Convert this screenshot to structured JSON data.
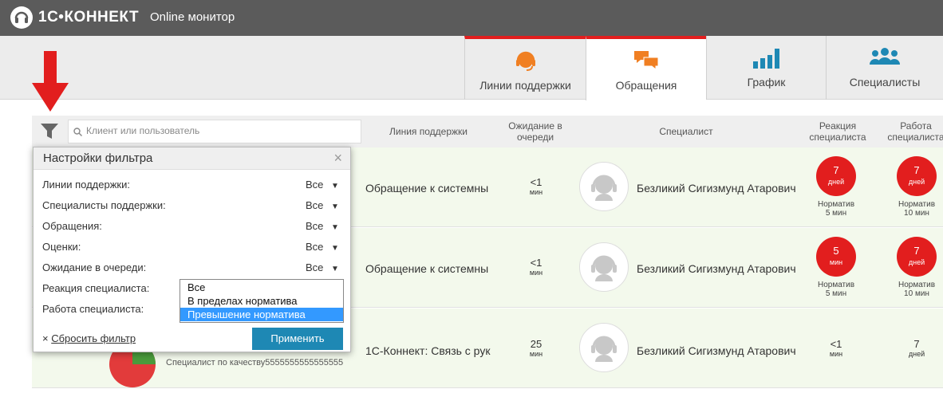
{
  "header": {
    "logo_text": "1С•КОННЕКТ",
    "app_title": "Online монитор"
  },
  "tabs": [
    {
      "label": "Линии поддержки",
      "icon": "headset-icon",
      "color": "#f07f22"
    },
    {
      "label": "Обращения",
      "icon": "chat-bubbles-icon",
      "color": "#f07f22"
    },
    {
      "label": "График",
      "icon": "bar-chart-icon",
      "color": "#1e88b4"
    },
    {
      "label": "Специалисты",
      "icon": "people-icon",
      "color": "#1e88b4"
    }
  ],
  "search": {
    "placeholder": "Клиент или пользователь"
  },
  "columns": {
    "line": "Линия поддержки",
    "wait": "Ожидание в очереди",
    "specialist": "Специалист",
    "reaction": "Реакция специалиста",
    "work": "Работа специалиста"
  },
  "rows": [
    {
      "topic": "Обращение к системны",
      "wait_value": "<1",
      "wait_unit": "мин",
      "specialist": "Безликий Сигизмунд Атарович",
      "reaction": {
        "value": "7",
        "unit": "дней",
        "norm_label": "Норматив",
        "norm_value": "5 мин"
      },
      "work": {
        "value": "7",
        "unit": "дней",
        "norm_label": "Норматив",
        "norm_value": "10 мин"
      }
    },
    {
      "topic": "Обращение к системны",
      "wait_value": "<1",
      "wait_unit": "мин",
      "specialist": "Безликий Сигизмунд Атарович",
      "reaction": {
        "value": "5",
        "unit": "мин",
        "norm_label": "Норматив",
        "norm_value": "5 мин"
      },
      "work": {
        "value": "7",
        "unit": "дней",
        "norm_label": "Норматив",
        "norm_value": "10 мин"
      }
    },
    {
      "topic": "1С-Коннект: Связь с рук",
      "wait_value": "25",
      "wait_unit": "мин",
      "specialist": "Безликий Сигизмунд Атарович",
      "client_note": "Специалист по качеству5555555555555555",
      "reaction": {
        "value": "<1",
        "unit": "мин"
      },
      "work": {
        "value": "7",
        "unit": "дней"
      }
    }
  ],
  "filter_panel": {
    "title": "Настройки фильтра",
    "close": "×",
    "fields": [
      {
        "label": "Линии поддержки:",
        "value": "Все"
      },
      {
        "label": "Специалисты поддержки:",
        "value": "Все"
      },
      {
        "label": "Обращения:",
        "value": "Все"
      },
      {
        "label": "Оценки:",
        "value": "Все"
      },
      {
        "label": "Ожидание в очереди:",
        "value": "Все"
      },
      {
        "label": "Реакция специалиста:",
        "value": ""
      },
      {
        "label": "Работа специалиста:",
        "value": ""
      }
    ],
    "dropdown_options": [
      "Все",
      "В пределах норматива",
      "Превышение норматива"
    ],
    "dropdown_selected": "Превышение норматива",
    "reset_icon": "×",
    "reset_label": "Сбросить фильтр",
    "apply_label": "Применить"
  },
  "colors": {
    "accent_red": "#e21e1e",
    "accent_blue": "#1e88b4",
    "accent_orange": "#f07f22"
  }
}
